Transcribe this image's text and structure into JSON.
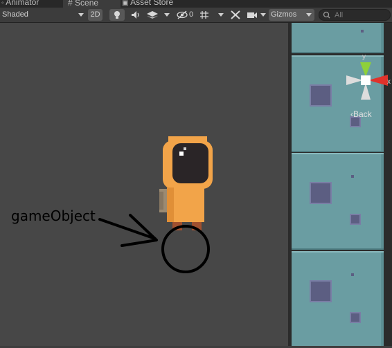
{
  "tabs": [
    {
      "label": "Animator",
      "icon": "animator-icon",
      "active": false
    },
    {
      "label": "Scene",
      "icon": "hash-icon",
      "active": true
    },
    {
      "label": "Asset Store",
      "icon": "store-icon",
      "active": false
    }
  ],
  "toolbar": {
    "draw_mode": "Shaded",
    "view_2d": "2D",
    "hidden_count": "0",
    "gizmos": "Gizmos",
    "search_placeholder": "All"
  },
  "scene_gizmo": {
    "y_axis": "y",
    "x_axis": "x",
    "back_label": "‹Back"
  },
  "annotation": {
    "label": "gameObject"
  },
  "colors": {
    "editor_background": "#474747",
    "tile": "#6a9da2",
    "character_orange": "#f2a449",
    "annotation_ink": "#000000",
    "gizmo_x": "#e0322b",
    "gizmo_y": "#8ed03b"
  }
}
